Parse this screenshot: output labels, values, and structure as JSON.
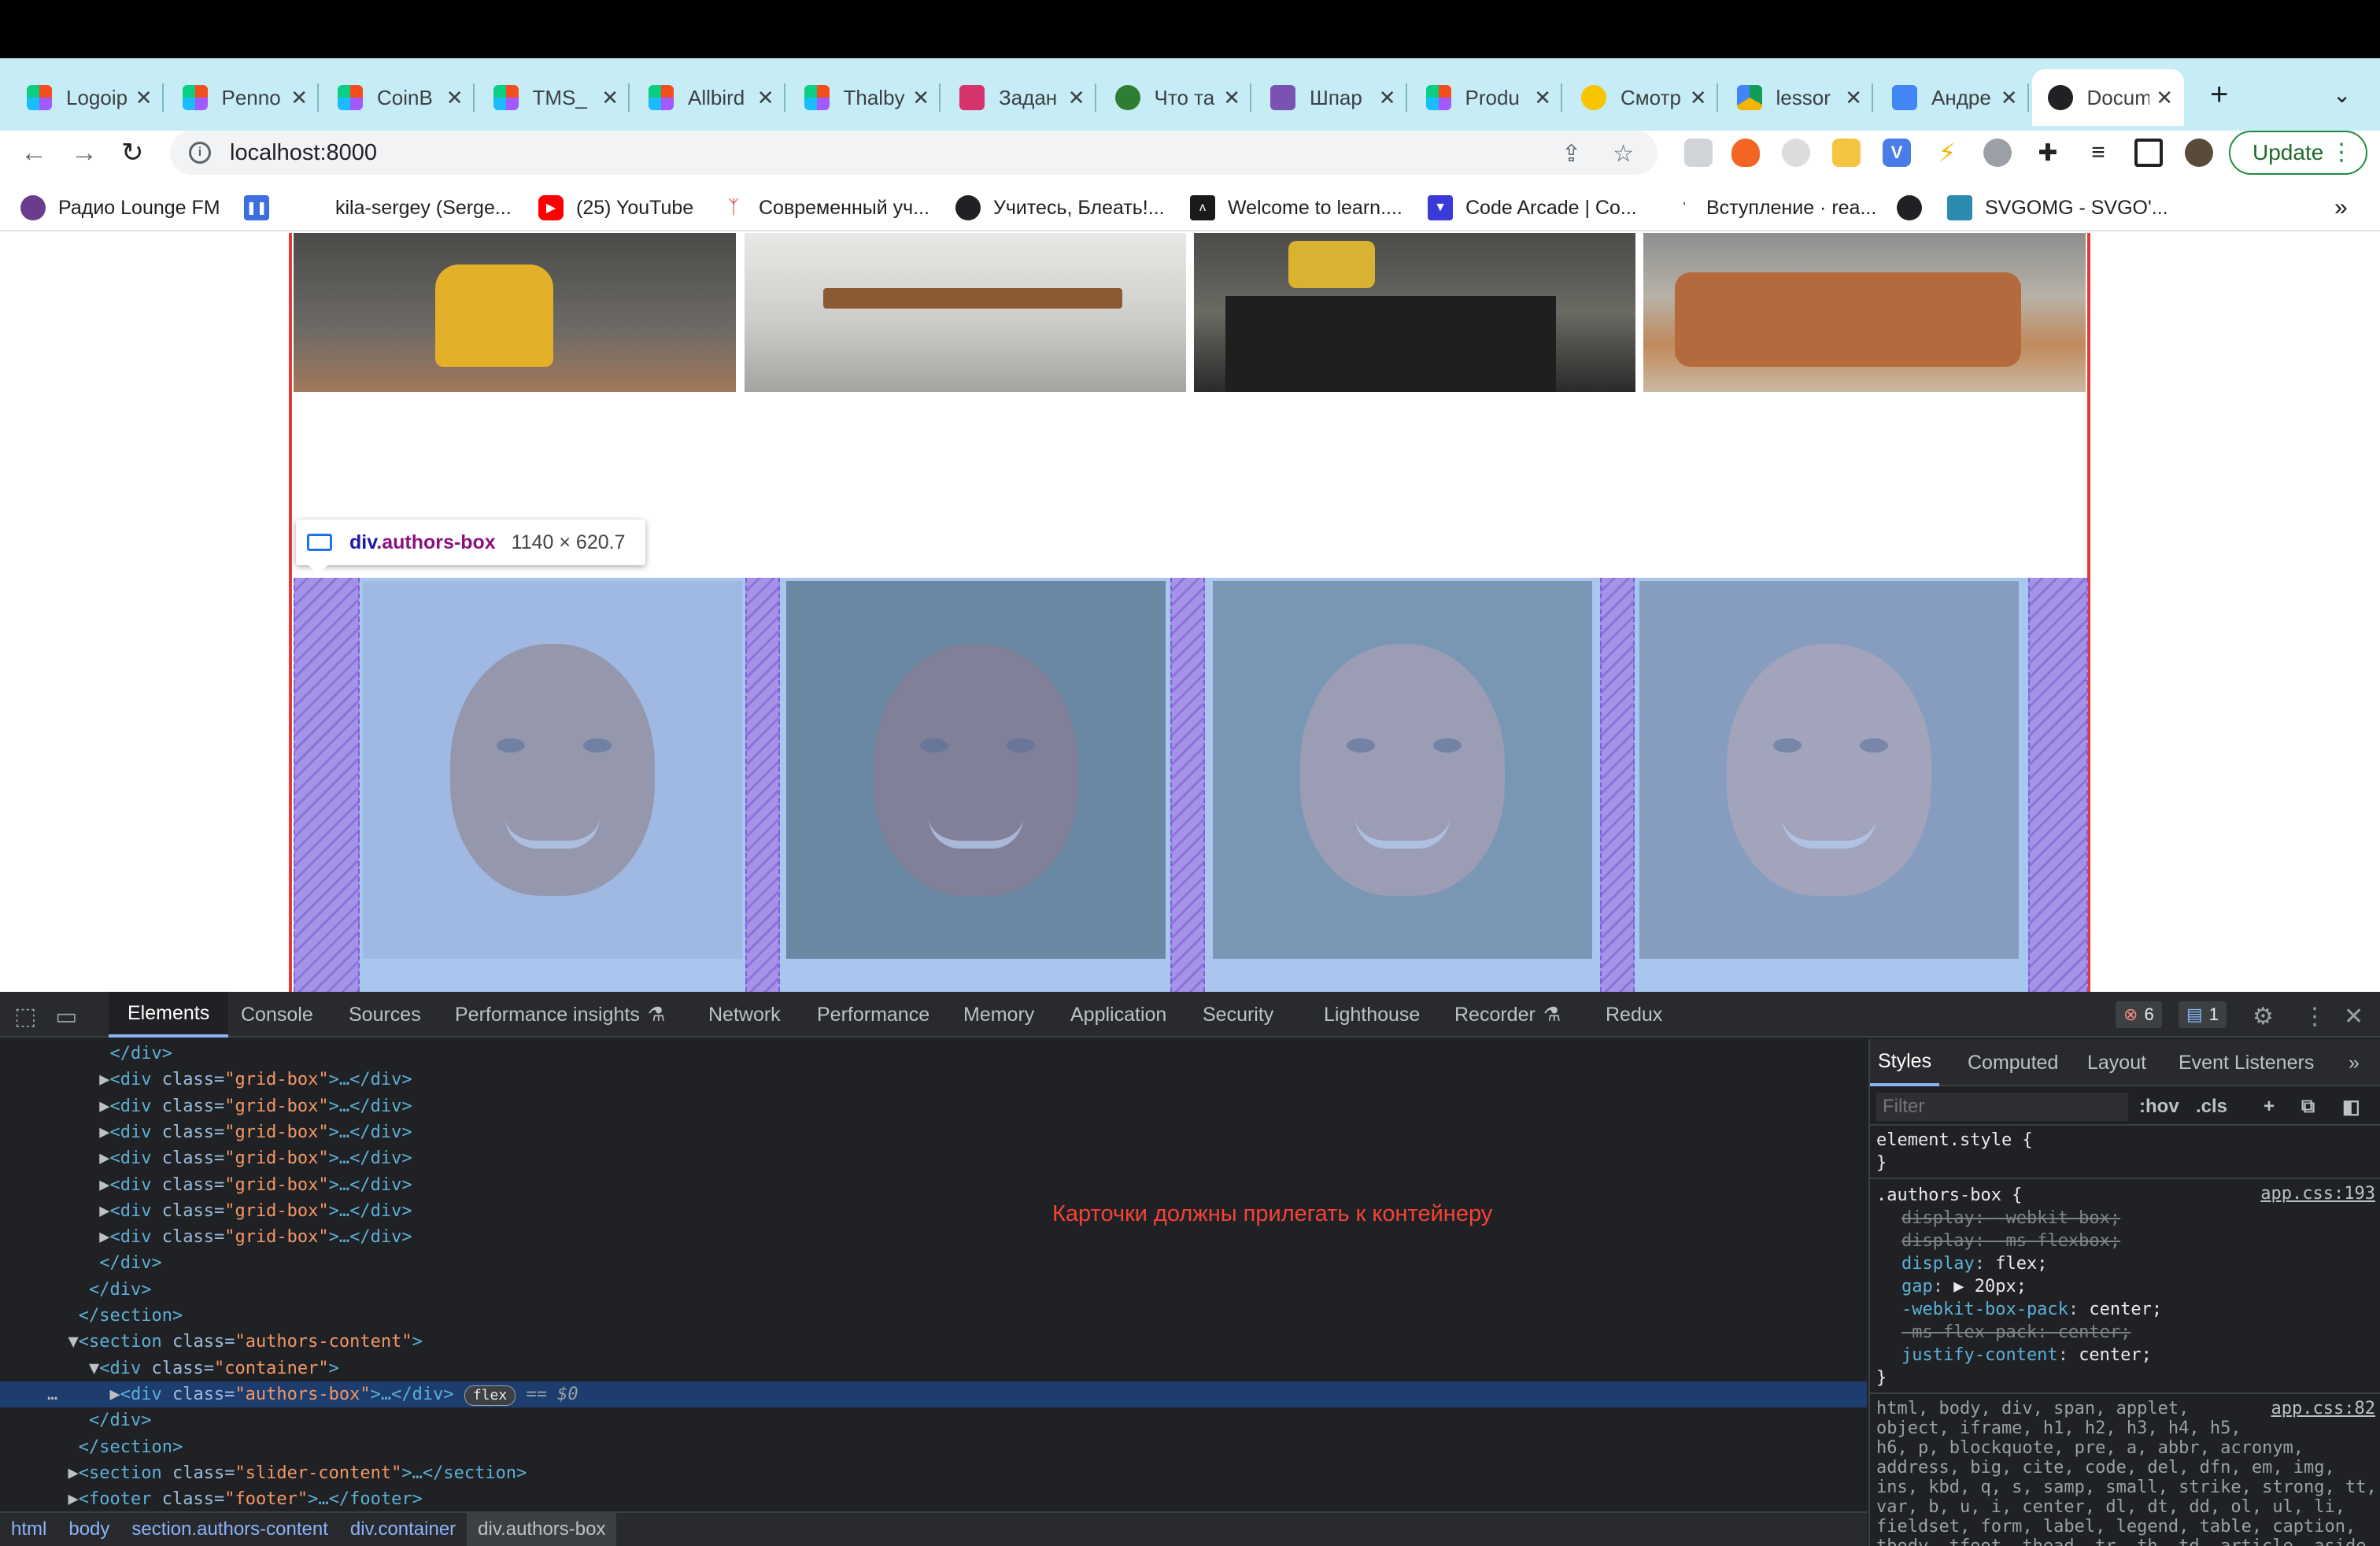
{
  "browser": {
    "tabs": [
      {
        "label": "Logoip",
        "icon": "figma-icon"
      },
      {
        "label": "Penno",
        "icon": "figma-icon"
      },
      {
        "label": "CoinB",
        "icon": "figma-icon"
      },
      {
        "label": "TMS_",
        "icon": "figma-icon"
      },
      {
        "label": "Allbird",
        "icon": "figma-icon"
      },
      {
        "label": "Thalby",
        "icon": "figma-icon"
      },
      {
        "label": "Задан",
        "icon": "profile-icon"
      },
      {
        "label": "Что та",
        "icon": "leaf-icon"
      },
      {
        "label": "Шпар",
        "icon": "bootstrap-icon"
      },
      {
        "label": "Produ",
        "icon": "figma-icon"
      },
      {
        "label": "Смотр",
        "icon": "ctc-icon"
      },
      {
        "label": "lessor",
        "icon": "drive-icon"
      },
      {
        "label": "Андре",
        "icon": "docs-icon"
      },
      {
        "label": "Docum",
        "icon": "globe-icon"
      }
    ],
    "url": "localhost:8000",
    "update_label": "Update",
    "bookmarks": [
      {
        "label": "Радио Lounge FM"
      },
      {
        "label": "kila-sergey (Serge..."
      },
      {
        "label": "(25) YouTube"
      },
      {
        "label": "Современный уч..."
      },
      {
        "label": "Учитесь, Блеать!..."
      },
      {
        "label": "Welcome to learn...."
      },
      {
        "label": "Code Arcade | Co..."
      },
      {
        "label": "Вступление · rea..."
      },
      {
        "label": "SVGOMG - SVGO'..."
      }
    ],
    "bookmarks_more": "»"
  },
  "page": {
    "tooltip": {
      "tag": "div",
      "class": ".authors-box",
      "size": "1140 × 620.7"
    }
  },
  "devtools": {
    "tabs": [
      "Elements",
      "Console",
      "Sources",
      "Performance insights",
      "Network",
      "Performance",
      "Memory",
      "Application",
      "Security",
      "Lighthouse",
      "Recorder",
      "Redux"
    ],
    "errors_count": "6",
    "messages_count": "1",
    "dom_lines": [
      {
        "indent": "      ",
        "text": "</div>"
      },
      {
        "indent": "     ▶",
        "tag": "<div ",
        "attr": "class=",
        "val": "\"grid-box\"",
        "tail": ">…</div>"
      },
      {
        "indent": "     ▶",
        "tag": "<div ",
        "attr": "class=",
        "val": "\"grid-box\"",
        "tail": ">…</div>"
      },
      {
        "indent": "     ▶",
        "tag": "<div ",
        "attr": "class=",
        "val": "\"grid-box\"",
        "tail": ">…</div>"
      },
      {
        "indent": "     ▶",
        "tag": "<div ",
        "attr": "class=",
        "val": "\"grid-box\"",
        "tail": ">…</div>"
      },
      {
        "indent": "     ▶",
        "tag": "<div ",
        "attr": "class=",
        "val": "\"grid-box\"",
        "tail": ">…</div>"
      },
      {
        "indent": "     ▶",
        "tag": "<div ",
        "attr": "class=",
        "val": "\"grid-box\"",
        "tail": ">…</div>"
      },
      {
        "indent": "     ▶",
        "tag": "<div ",
        "attr": "class=",
        "val": "\"grid-box\"",
        "tail": ">…</div>"
      },
      {
        "indent": "     ",
        "text": "</div>"
      },
      {
        "indent": "    ",
        "text": "</div>"
      },
      {
        "indent": "   ",
        "text": "</section>"
      },
      {
        "indent": "  ▼",
        "tag": "<section ",
        "attr": "class=",
        "val": "\"authors-content\"",
        "tail": ">"
      },
      {
        "indent": "    ▼",
        "tag": "<div ",
        "attr": "class=",
        "val": "\"container\"",
        "tail": ">"
      },
      {
        "indent": "…     ▶",
        "tag": "<div ",
        "attr": "class=",
        "val": "\"authors-box\"",
        "tail": ">…</div>",
        "pill": "flex",
        "suffix": " == $0",
        "selected": true
      },
      {
        "indent": "    ",
        "text": "</div>"
      },
      {
        "indent": "   ",
        "text": "</section>"
      },
      {
        "indent": "  ▶",
        "tag": "<section ",
        "attr": "class=",
        "val": "\"slider-content\"",
        "tail": ">…</section>"
      },
      {
        "indent": "  ▶",
        "tag": "<footer ",
        "attr": "class=",
        "val": "\"footer\"",
        "tail": ">…</footer>"
      }
    ],
    "annotation": "Карточки должны прилегать к контейнеру",
    "breadcrumbs": [
      "html",
      "body",
      "section.authors-content",
      "div.container",
      "div.authors-box"
    ],
    "styles_tabs": [
      "Styles",
      "Computed",
      "Layout",
      "Event Listeners",
      "»"
    ],
    "filter_placeholder": "Filter",
    "filter_hov": ":hov",
    "filter_cls": ".cls",
    "rules": {
      "element_style": "element.style {",
      "close": "}",
      "authors_selector": ".authors-box {",
      "authors_source": "app.css:193",
      "decls": [
        {
          "prop": "display",
          "value": "-webkit-box;",
          "strike": true
        },
        {
          "prop": "display",
          "value": "-ms-flexbox;",
          "strike": true
        },
        {
          "prop": "display",
          "value": "flex;",
          "strike": false
        },
        {
          "prop": "gap",
          "value": "▶ 20px;",
          "strike": false
        },
        {
          "prop": "-webkit-box-pack",
          "value": "center;",
          "strike": false
        },
        {
          "prop": "-ms-flex-pack",
          "value": "center;",
          "strike": true
        },
        {
          "prop": "justify-content",
          "value": "center;",
          "strike": false
        }
      ],
      "reset_source": "app.css:82",
      "reset_lines": [
        "html, body, div, span, applet,",
        "object, iframe, h1, h2, h3, h4, h5,",
        "h6, p, blockquote, pre, a, abbr, acronym,",
        "address, big, cite, code, del, dfn, em, img,",
        "ins, kbd, q, s, samp, small, strike, strong, tt,",
        "var, b, u, i, center, dl, dt, dd, ol, ul, li,",
        "fieldset, form, label, legend, table, caption,",
        "tbody, tfoot, thead, tr, th, td, article, aside,"
      ]
    }
  }
}
